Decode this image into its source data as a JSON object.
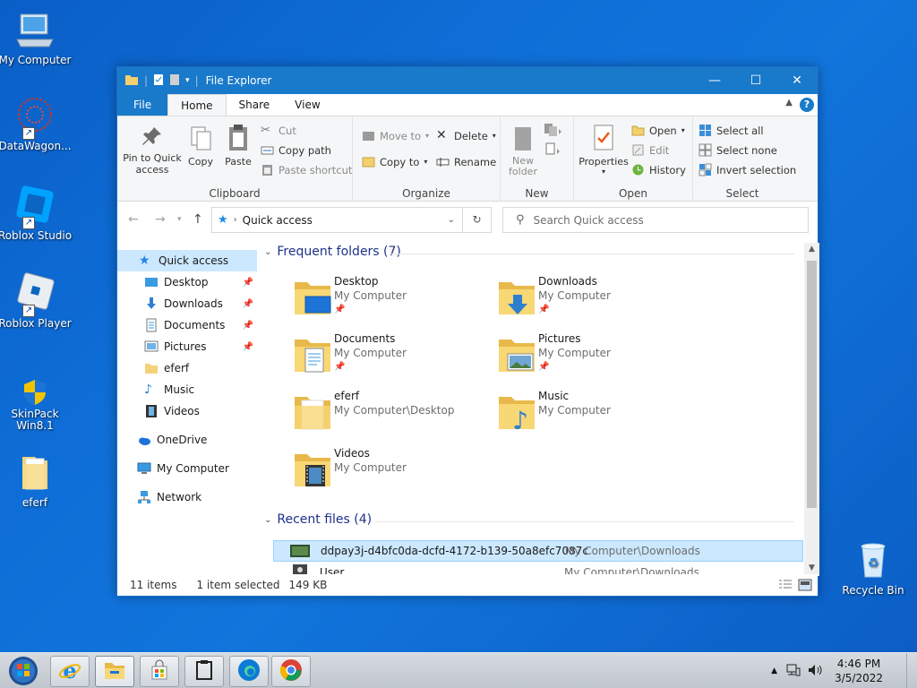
{
  "desktop": {
    "icons": [
      {
        "label": "My Computer"
      },
      {
        "label": "DataWagon..."
      },
      {
        "label": "Roblox Studio"
      },
      {
        "label": "Roblox Player"
      },
      {
        "label": "SkinPack Win8.1"
      },
      {
        "label": "eferf"
      },
      {
        "label": "Recycle Bin"
      }
    ]
  },
  "window": {
    "title": "File Explorer",
    "controls": {
      "minimize": "—",
      "maximize": "☐",
      "close": "✕"
    }
  },
  "ribbon_tabs": [
    "File",
    "Home",
    "Share",
    "View"
  ],
  "ribbon": {
    "clipboard": {
      "label": "Clipboard",
      "pin": "Pin to Quick access",
      "copy": "Copy",
      "paste": "Paste",
      "cut": "Cut",
      "copy_path": "Copy path",
      "paste_shortcut": "Paste shortcut"
    },
    "organize": {
      "label": "Organize",
      "move_to": "Move to",
      "copy_to": "Copy to",
      "delete": "Delete",
      "rename": "Rename"
    },
    "new": {
      "label": "New",
      "new_folder": "New folder"
    },
    "open": {
      "label": "Open",
      "properties": "Properties",
      "open": "Open",
      "edit": "Edit",
      "history": "History"
    },
    "select": {
      "label": "Select",
      "select_all": "Select all",
      "select_none": "Select none",
      "invert": "Invert selection"
    }
  },
  "address": {
    "path": "Quick access",
    "search_placeholder": "Search Quick access"
  },
  "nav": {
    "items": [
      {
        "label": "Quick access"
      },
      {
        "label": "Desktop"
      },
      {
        "label": "Downloads"
      },
      {
        "label": "Documents"
      },
      {
        "label": "Pictures"
      },
      {
        "label": "eferf"
      },
      {
        "label": "Music"
      },
      {
        "label": "Videos"
      },
      {
        "label": "OneDrive"
      },
      {
        "label": "My Computer"
      },
      {
        "label": "Network"
      }
    ]
  },
  "content": {
    "frequent_header": "Frequent folders (7)",
    "folders": [
      {
        "name": "Desktop",
        "location": "My Computer"
      },
      {
        "name": "Downloads",
        "location": "My Computer"
      },
      {
        "name": "Documents",
        "location": "My Computer"
      },
      {
        "name": "Pictures",
        "location": "My Computer"
      },
      {
        "name": "eferf",
        "location": "My Computer\\Desktop"
      },
      {
        "name": "Music",
        "location": "My Computer"
      },
      {
        "name": "Videos",
        "location": "My Computer"
      }
    ],
    "recent_header": "Recent files (4)",
    "recent": [
      {
        "name": "ddpay3j-d4bfc0da-dcfd-4172-b139-50a8efc7087c",
        "path": "My Computer\\Downloads"
      },
      {
        "name": "User",
        "path": "My Computer\\Downloads"
      }
    ]
  },
  "status": {
    "items": "11 items",
    "selected": "1 item selected",
    "size": "149 KB"
  },
  "taskbar": {
    "time": "4:46 PM",
    "date": "3/5/2022"
  },
  "colors": {
    "titlebar": "#1979ca",
    "selection": "#cce8ff",
    "header_text": "#1e3287"
  }
}
